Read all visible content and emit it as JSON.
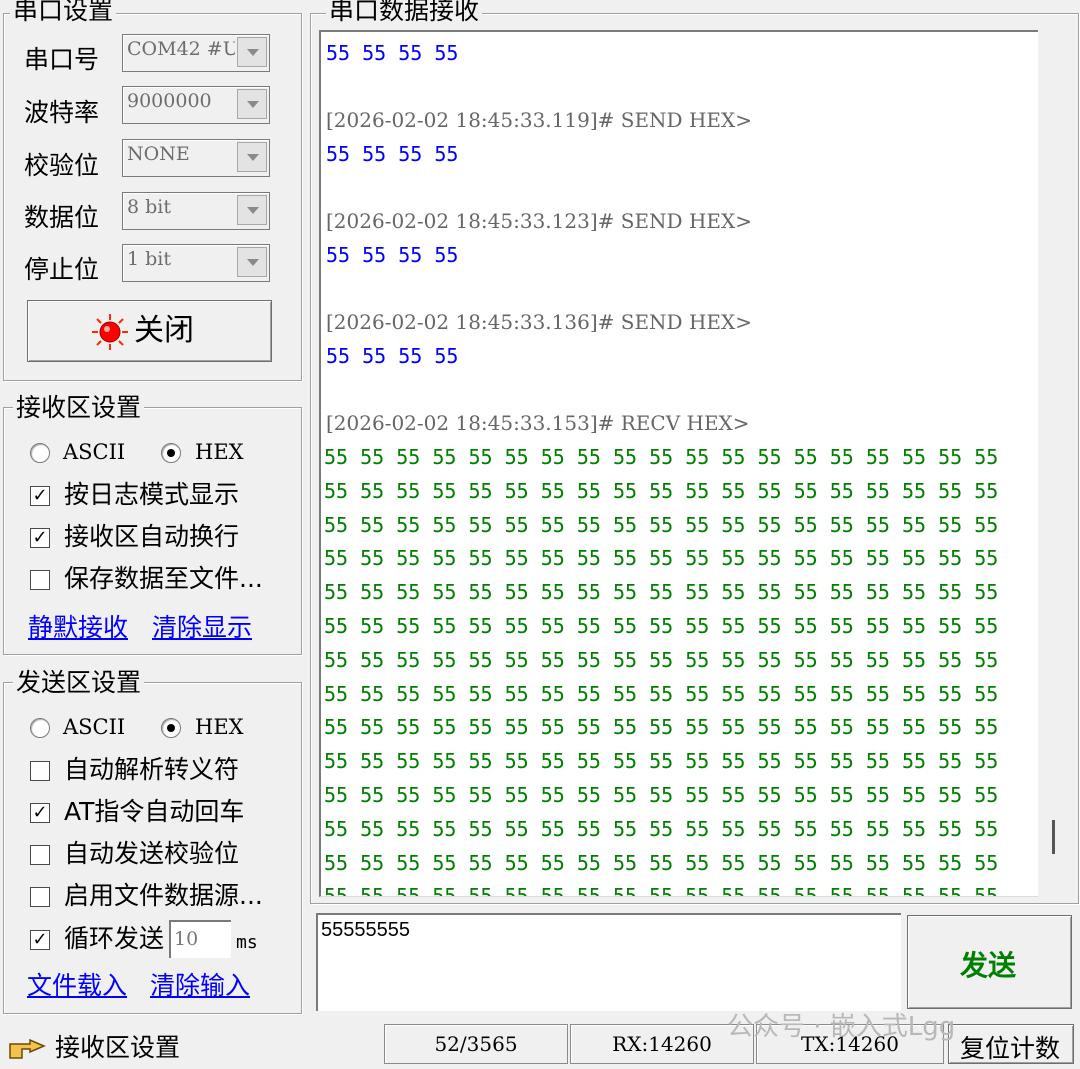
{
  "serial": {
    "title": "串口设置",
    "port_label": "串口号",
    "port_value": "COM42 #U:",
    "baud_label": "波特率",
    "baud_value": "9000000",
    "parity_label": "校验位",
    "parity_value": "NONE",
    "databits_label": "数据位",
    "databits_value": "8 bit",
    "stopbits_label": "停止位",
    "stopbits_value": "1 bit",
    "close_button": "关闭"
  },
  "recv_settings": {
    "title": "接收区设置",
    "ascii": "ASCII",
    "hex": "HEX",
    "mode": "HEX",
    "log_mode": {
      "label": "按日志模式显示",
      "checked": true
    },
    "auto_wrap": {
      "label": "接收区自动换行",
      "checked": true
    },
    "save_file": {
      "label": "保存数据至文件...",
      "checked": false
    },
    "silent_link": "静默接收",
    "clear_link": "清除显示"
  },
  "send_settings": {
    "title": "发送区设置",
    "ascii": "ASCII",
    "hex": "HEX",
    "mode": "HEX",
    "escape": {
      "label": "自动解析转义符",
      "checked": false
    },
    "at_cr": {
      "label": "AT指令自动回车",
      "checked": true
    },
    "checksum": {
      "label": "自动发送校验位",
      "checked": false
    },
    "file_src": {
      "label": "启用文件数据源...",
      "checked": false
    },
    "loop": {
      "label": "循环发送",
      "checked": true,
      "interval": "10",
      "unit": "ms"
    },
    "load_link": "文件载入",
    "clear_input_link": "清除输入"
  },
  "recv_area": {
    "title": "串口数据接收",
    "top_line": "55 55 55 55",
    "entries": [
      {
        "stamp": "[2026-02-02 18:45:33.119]# SEND HEX>",
        "data": "55 55 55 55"
      },
      {
        "stamp": "[2026-02-02 18:45:33.123]# SEND HEX>",
        "data": "55 55 55 55"
      },
      {
        "stamp": "[2026-02-02 18:45:33.136]# SEND HEX>",
        "data": "55 55 55 55"
      }
    ],
    "recv_stamp": "[2026-02-02 18:45:33.153]# RECV HEX>",
    "recv_row": "55 55 55 55 55 55 55 55 55 55 55 55 55 55 55 55 55 55 55",
    "recv_row_count": 14
  },
  "send_area": {
    "value": "55555555",
    "send_button": "发送"
  },
  "statusbar": {
    "hint": "接收区设置",
    "lines": "52/3565",
    "rx": "RX:14260",
    "tx": "TX:14260",
    "reset_button": "复位计数"
  },
  "watermark": "公众号 · 嵌入式Lgg",
  "colors": {
    "send_text": "#0000ff",
    "recv_text": "#008000",
    "timestamp": "#666666",
    "link": "#0000ff",
    "led": "#ff0000"
  }
}
